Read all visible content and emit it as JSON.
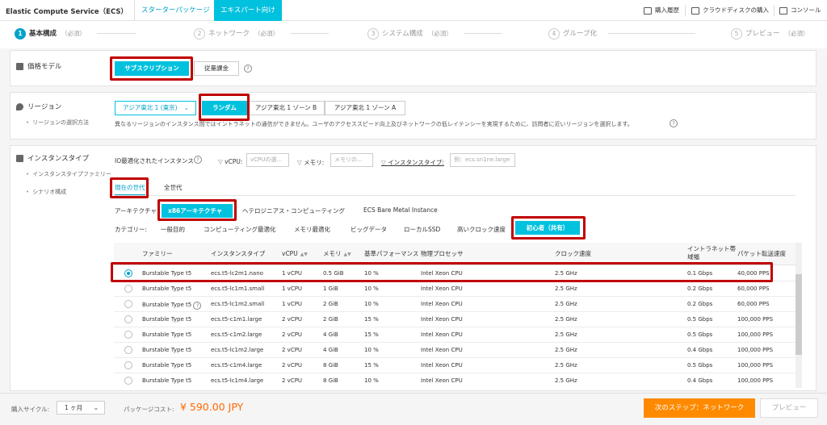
{
  "header": {
    "title": "Elastic Compute Service（ECS）",
    "tabs": [
      "スターターパッケージ",
      "エキスパート向け"
    ],
    "links": [
      "購入履歴",
      "クラウドディスクの購入",
      "コンソール"
    ]
  },
  "steps": [
    {
      "num": "1",
      "label": "基本構成",
      "req": "（必須）"
    },
    {
      "num": "2",
      "label": "ネットワーク",
      "req": "（必須）"
    },
    {
      "num": "3",
      "label": "システム構成",
      "req": "（必須）"
    },
    {
      "num": "4",
      "label": "グループ化",
      "req": ""
    },
    {
      "num": "5",
      "label": "プレビュー",
      "req": "（必須）"
    }
  ],
  "pricing": {
    "label": "価格モデル",
    "options": [
      "サブスクリプション",
      "従量課金"
    ],
    "selected": "サブスクリプション"
  },
  "region": {
    "label": "リージョン",
    "sub": "リージョンの選択方法",
    "dropdown": "アジア東北 1 (東京)",
    "zones": [
      "ランダム",
      "アジア東北 1 ゾーン B",
      "アジア東北 1 ゾーン A"
    ],
    "selected": "ランダム",
    "note": "異なるリージョンのインスタンス間ではイントラネットの通信ができません。ユーザのアクセススピード向上及びネットワークの低レイテンシーを実現するために、訪問者に近いリージョンを選択します。"
  },
  "instance": {
    "label": "インスタンスタイプ",
    "subs": [
      "インスタンスタイプファミリー",
      "シナリオ構成"
    ],
    "filters": {
      "io_label": "IO最適化されたインスタンス",
      "vcpu_label": "vCPU:",
      "vcpu_placeholder": "vCPUの選...",
      "mem_label": "メモリ:",
      "mem_placeholder": "メモリの...",
      "type_label": "インスタンスタイプ:",
      "type_placeholder": "例：ecs.sn1ne.large"
    },
    "generation_tabs": [
      "現在の世代",
      "全世代"
    ],
    "arch_label": "アーキテクチャ:",
    "arch": [
      "x86アーキテクチャ",
      "ヘテロジニアス・コンピューティング",
      "ECS Bare Metal Instance"
    ],
    "cat_label": "カテゴリー:",
    "categories": [
      "一般目的",
      "コンピューティング最適化",
      "メモリ最適化",
      "ビッグデータ",
      "ローカルSSD",
      "高いクロック速度",
      "初心者（共有）"
    ]
  },
  "table": {
    "columns": [
      "ファミリー",
      "インスタンスタイプ",
      "vCPU",
      "メモリ",
      "基準パフォーマンス",
      "物理プロセッサ",
      "クロック速度",
      "イントラネット帯域幅",
      "パケット転送速度"
    ],
    "rows": [
      [
        "Burstable Type t5",
        "ecs.t5-lc2m1.nano",
        "1 vCPU",
        "0.5 GiB",
        "10 %",
        "Intel Xeon CPU",
        "2.5 GHz",
        "0.1 Gbps",
        "40,000 PPS"
      ],
      [
        "Burstable Type t5",
        "ecs.t5-lc1m1.small",
        "1 vCPU",
        "1 GiB",
        "10 %",
        "Intel Xeon CPU",
        "2.5 GHz",
        "0.2 Gbps",
        "60,000 PPS"
      ],
      [
        "Burstable Type t5",
        "ecs.t5-lc1m2.small",
        "1 vCPU",
        "2 GiB",
        "10 %",
        "Intel Xeon CPU",
        "2.5 GHz",
        "0.2 Gbps",
        "60,000 PPS"
      ],
      [
        "Burstable Type t5",
        "ecs.t5-c1m1.large",
        "2 vCPU",
        "2 GiB",
        "15 %",
        "Intel Xeon CPU",
        "2.5 GHz",
        "0.5 Gbps",
        "100,000 PPS"
      ],
      [
        "Burstable Type t5",
        "ecs.t5-c1m2.large",
        "2 vCPU",
        "4 GiB",
        "15 %",
        "Intel Xeon CPU",
        "2.5 GHz",
        "0.5 Gbps",
        "100,000 PPS"
      ],
      [
        "Burstable Type t5",
        "ecs.t5-lc1m2.large",
        "2 vCPU",
        "4 GiB",
        "10 %",
        "Intel Xeon CPU",
        "2.5 GHz",
        "0.4 Gbps",
        "100,000 PPS"
      ],
      [
        "Burstable Type t5",
        "ecs.t5-c1m4.large",
        "2 vCPU",
        "8 GiB",
        "15 %",
        "Intel Xeon CPU",
        "2.5 GHz",
        "0.5 Gbps",
        "100,000 PPS"
      ],
      [
        "Burstable Type t5",
        "ecs.t5-lc1m4.large",
        "2 vCPU",
        "8 GiB",
        "10 %",
        "Intel Xeon CPU",
        "2.5 GHz",
        "0.4 Gbps",
        "100,000 PPS"
      ]
    ]
  },
  "footer": {
    "cycle_label": "購入サイクル:",
    "cycle_value": "1 ヶ月",
    "cost_label": "パッケージコスト:",
    "price": "¥ 590.00 JPY",
    "next": "次のステップ：ネットワーク",
    "preview": "プレビュー"
  },
  "colors": {
    "accent": "#00c1de",
    "link": "#00a2ca",
    "highlight": "#c00000",
    "cta": "#ff8a00"
  }
}
